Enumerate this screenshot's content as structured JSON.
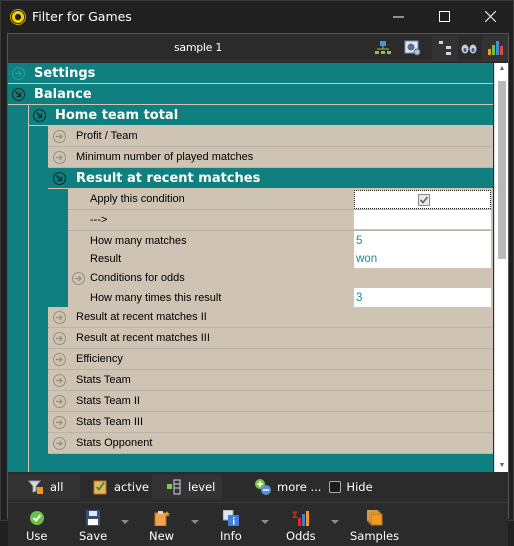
{
  "window": {
    "title": "Filter for Games",
    "controls": [
      "minimize",
      "maximize",
      "close"
    ]
  },
  "header": {
    "sample_name": "sample 1",
    "icons": [
      "network-icon",
      "settings-window-icon",
      "tree-structure-icon",
      "binoculars-icon",
      "bar-chart-icon"
    ]
  },
  "tree": {
    "groups": {
      "settings": "Settings",
      "balance": "Balance",
      "home_team_total": "Home team total",
      "result_recent": "Result at recent matches"
    },
    "home_items": {
      "profit_team": "Profit / Team",
      "min_matches": "Minimum number of played matches"
    },
    "conditions": [
      {
        "label": "Apply this condition",
        "value": "",
        "checked": true
      },
      {
        "label": "--->",
        "value": ""
      },
      {
        "label": "How many matches",
        "value": "5"
      },
      {
        "label": "Result",
        "value": "won"
      },
      {
        "label": "Conditions for odds"
      },
      {
        "label": "How many times this result",
        "value": "3"
      }
    ],
    "more_items": [
      "Result at recent matches II",
      "Result at recent matches III",
      "Efficiency",
      "Stats Team",
      "Stats Team II",
      "Stats Team III",
      "Stats Opponent"
    ]
  },
  "tabs": {
    "all": "all",
    "active": "active",
    "level": "level",
    "more": "more ...",
    "hide": "Hide",
    "hide_checked": false
  },
  "toolbar": {
    "use": "Use",
    "save": "Save",
    "new": "New",
    "info": "Info",
    "odds": "Odds",
    "samples": "Samples"
  },
  "colors": {
    "group_bg": "#0f7f80",
    "item_bg": "#cfc4b3",
    "value_text": "#178f8f",
    "window_bg": "#202020"
  }
}
